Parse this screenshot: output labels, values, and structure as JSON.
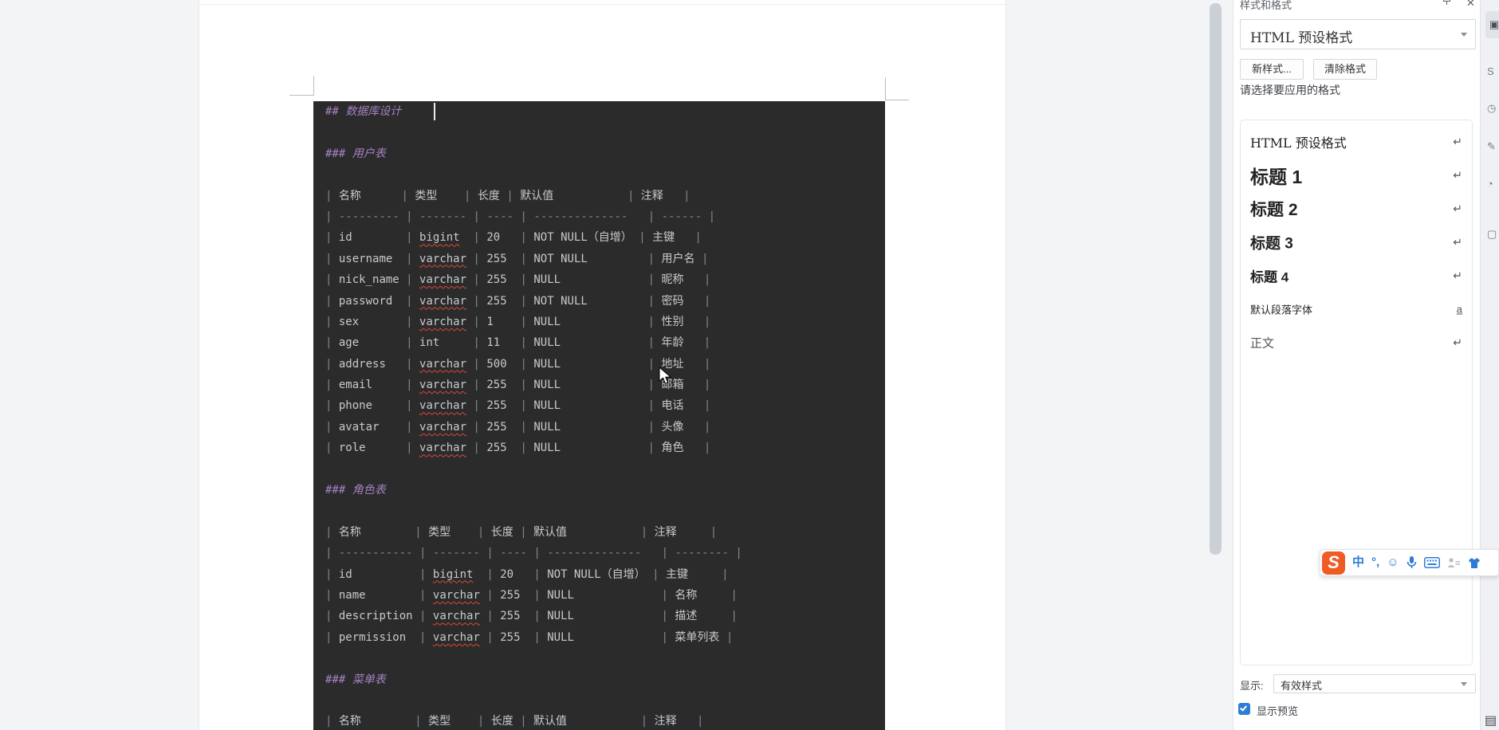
{
  "colors": {
    "editor_background": "#2b2b2b",
    "heading_purple": "#a581c2",
    "body_text": "#c7cacc",
    "squiggle_red": "#d84a3a",
    "accent_blue": "#2f7cd6",
    "sogou_orange": "#f05a23"
  },
  "document": {
    "spellcheck_words": [
      "bigint",
      "varchar"
    ],
    "lines": [
      {
        "t": "## 数据库设计",
        "s": "h2",
        "cursor": true
      },
      {
        "t": "",
        "s": "blank"
      },
      {
        "t": "### 用户表",
        "s": "h3"
      },
      {
        "t": "",
        "s": "blank"
      },
      {
        "t": "| 名称      | 类型    | 长度 | 默认值           | 注释   |",
        "s": "row"
      },
      {
        "t": "| --------- | ------- | ---- | --------------   | ------ |",
        "s": "row"
      },
      {
        "t": "| id        | bigint  | 20   | NOT NULL（自增） | 主键   |",
        "s": "row"
      },
      {
        "t": "| username  | varchar | 255  | NOT NULL         | 用户名 |",
        "s": "row"
      },
      {
        "t": "| nick_name | varchar | 255  | NULL             | 昵称   |",
        "s": "row"
      },
      {
        "t": "| password  | varchar | 255  | NOT NULL         | 密码   |",
        "s": "row"
      },
      {
        "t": "| sex       | varchar | 1    | NULL             | 性别   |",
        "s": "row"
      },
      {
        "t": "| age       | int     | 11   | NULL             | 年龄   |",
        "s": "row"
      },
      {
        "t": "| address   | varchar | 500  | NULL             | 地址   |",
        "s": "row"
      },
      {
        "t": "| email     | varchar | 255  | NULL             | 邮箱   |",
        "s": "row"
      },
      {
        "t": "| phone     | varchar | 255  | NULL             | 电话   |",
        "s": "row"
      },
      {
        "t": "| avatar    | varchar | 255  | NULL             | 头像   |",
        "s": "row"
      },
      {
        "t": "| role      | varchar | 255  | NULL             | 角色   |",
        "s": "row"
      },
      {
        "t": "",
        "s": "blank"
      },
      {
        "t": "### 角色表",
        "s": "h3"
      },
      {
        "t": "",
        "s": "blank"
      },
      {
        "t": "| 名称        | 类型    | 长度 | 默认值           | 注释     |",
        "s": "row"
      },
      {
        "t": "| ----------- | ------- | ---- | --------------   | -------- |",
        "s": "row"
      },
      {
        "t": "| id          | bigint  | 20   | NOT NULL（自增） | 主键     |",
        "s": "row"
      },
      {
        "t": "| name        | varchar | 255  | NULL             | 名称     |",
        "s": "row"
      },
      {
        "t": "| description | varchar | 255  | NULL             | 描述     |",
        "s": "row"
      },
      {
        "t": "| permission  | varchar | 255  | NULL             | 菜单列表 |",
        "s": "row"
      },
      {
        "t": "",
        "s": "blank"
      },
      {
        "t": "### 菜单表",
        "s": "h3"
      },
      {
        "t": "",
        "s": "blank"
      },
      {
        "t": "| 名称        | 类型    | 长度 | 默认值           | 注释   |",
        "s": "row"
      }
    ]
  },
  "styles_panel": {
    "title": "样式和格式",
    "preset_value": "HTML 预设格式",
    "new_style_button": "新样式...",
    "clear_format_button": "清除格式",
    "prompt": "请选择要应用的格式",
    "styles": [
      {
        "label": "HTML 预设格式",
        "icon": "↵",
        "kind": "preset"
      },
      {
        "label": "标题 1",
        "icon": "↵",
        "kind": "h1"
      },
      {
        "label": "标题 2",
        "icon": "↵",
        "kind": "h2"
      },
      {
        "label": "标题 3",
        "icon": "↵",
        "kind": "h3"
      },
      {
        "label": "标题 4",
        "icon": "↵",
        "kind": "h4"
      },
      {
        "label": "默认段落字体",
        "icon": "a",
        "kind": "default"
      },
      {
        "label": "正文",
        "icon": "↵",
        "kind": "body"
      }
    ],
    "display_label": "显示:",
    "display_value": "有效样式",
    "preview_label": "显示预览",
    "preview_checked": true
  },
  "ime_bar": {
    "logo_letter": "S",
    "mode_label": "中",
    "punct_label": "°,",
    "emoji_label": "☺"
  },
  "right_strip": {
    "icons": [
      {
        "name": "panel-tab",
        "char": "▣"
      },
      {
        "name": "share",
        "char": "S"
      },
      {
        "name": "clock",
        "char": "◷"
      },
      {
        "name": "edit",
        "char": "✎"
      },
      {
        "name": "contact",
        "char": "◔"
      },
      {
        "name": "box",
        "char": "▢"
      },
      {
        "name": "menu-bottom",
        "char": "▤"
      }
    ]
  }
}
